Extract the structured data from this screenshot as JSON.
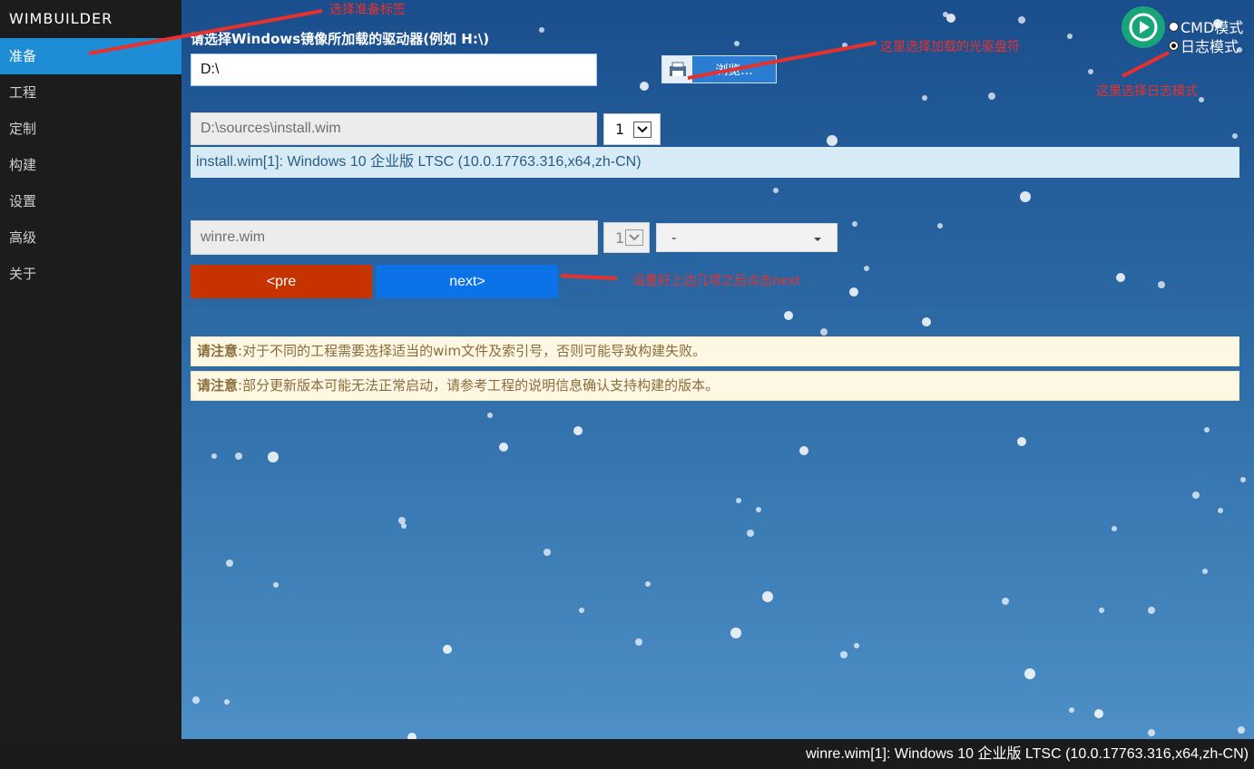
{
  "app": {
    "title": "WIMBUILDER"
  },
  "sidebar": {
    "items": [
      {
        "label": "准备",
        "active": true
      },
      {
        "label": "工程"
      },
      {
        "label": "定制"
      },
      {
        "label": "构建"
      },
      {
        "label": "设置"
      },
      {
        "label": "高级"
      },
      {
        "label": "关于"
      }
    ]
  },
  "source": {
    "drive_label": "请选择Windows镜像所加载的驱动器(例如 H:\\)",
    "drive_value": "D:\\",
    "browse_label": "浏览...",
    "browse_icon": "printer-folder-icon"
  },
  "install_wim": {
    "path": "D:\\sources\\install.wim",
    "index": "1",
    "info": "install.wim[1]: Windows 10 企业版 LTSC (10.0.17763.316,x64,zh-CN)"
  },
  "winre": {
    "path": "winre.wim",
    "index": "1",
    "arch": "-"
  },
  "buttons": {
    "pre": "<pre",
    "next": "next>"
  },
  "notices": [
    {
      "title": "请注意",
      "text": ":对于不同的工程需要选择适当的wim文件及索引号，否则可能导致构建失败。"
    },
    {
      "title": "请注意",
      "text": ":部分更新版本可能无法正常启动，请参考工程的说明信息确认支持构建的版本。"
    }
  ],
  "mode": {
    "cmd_label": "CMD模式",
    "log_label": "日志模式",
    "selected": "log"
  },
  "annotations": {
    "select_prepare": "选择准备标签",
    "select_drive": "这里选择加载的光驱盘符",
    "select_log": "这里选择日志模式",
    "click_next": "设置好上边几项之后点击next"
  },
  "statusbar": {
    "text": "winre.wim[1]: Windows 10 企业版 LTSC (10.0.17763.316,x64,zh-CN)"
  },
  "colors": {
    "accent": "#1f8dd6",
    "pre_button": "#c63200",
    "next_button": "#0b72e8",
    "annotation": "#e8312d",
    "run_button": "#19a57a"
  }
}
